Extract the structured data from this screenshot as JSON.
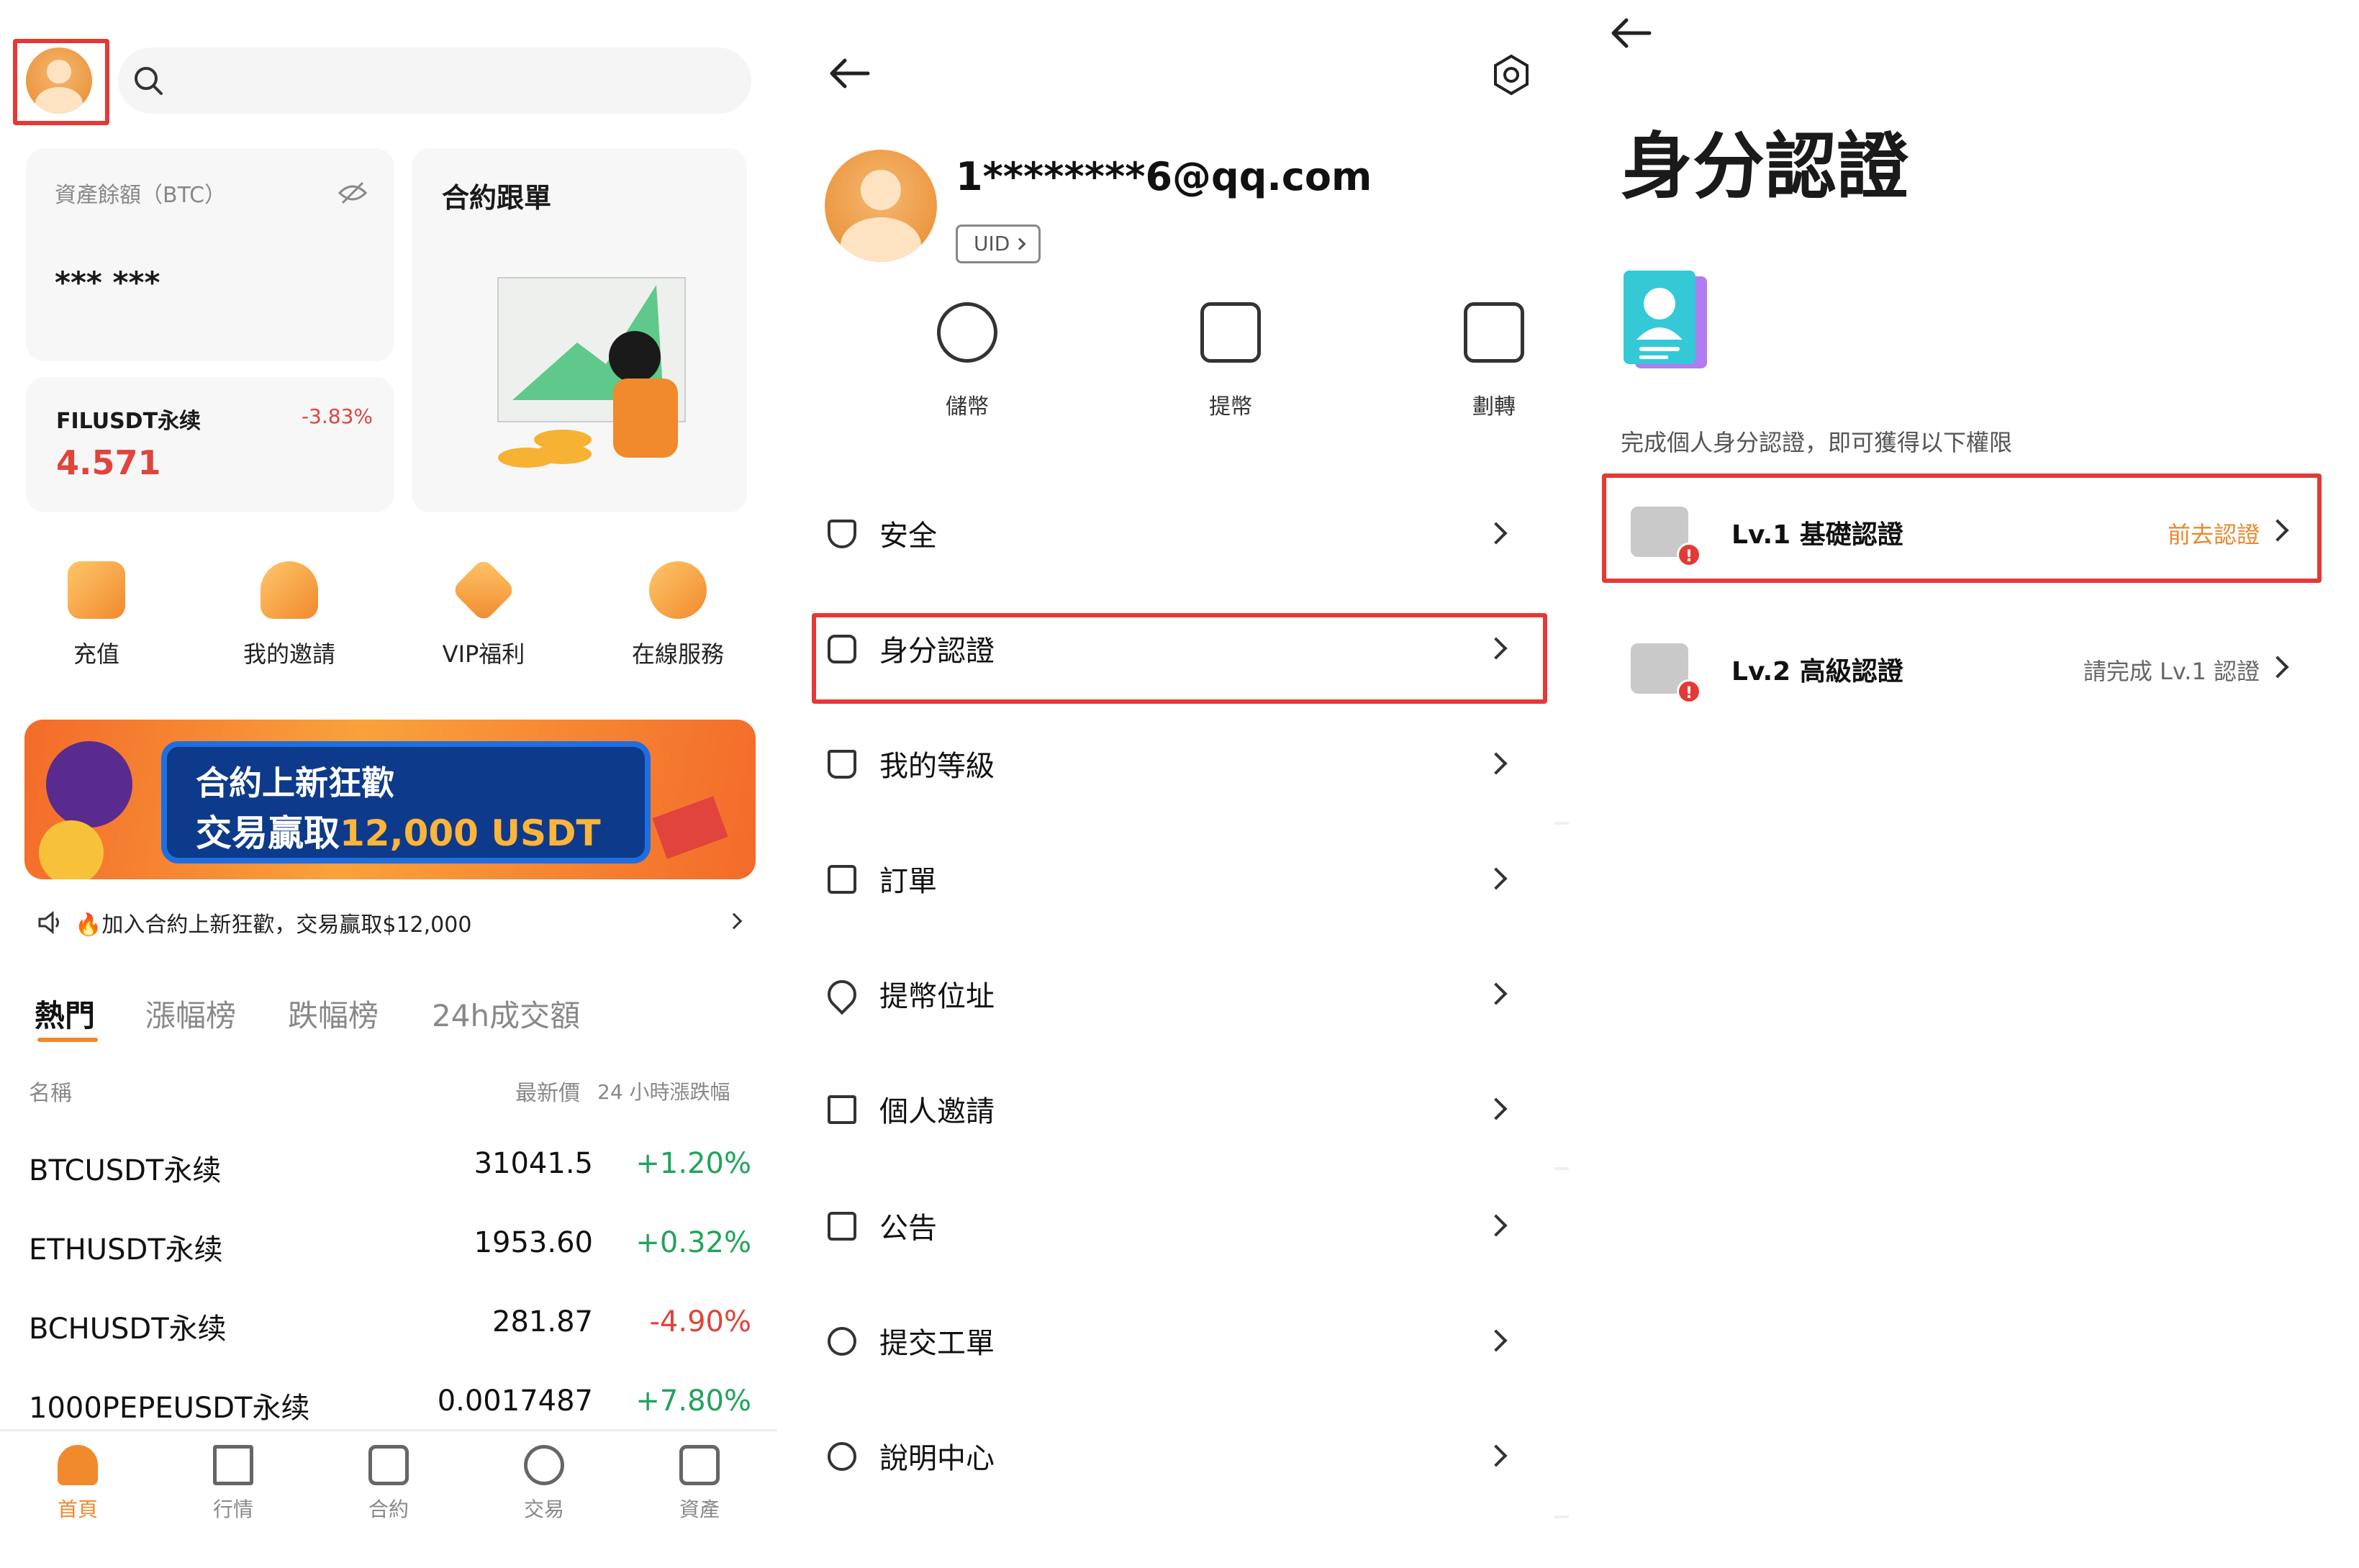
{
  "home": {
    "balance": {
      "label": "資產餘額（BTC）",
      "value": "*** ***"
    },
    "copy_trading": {
      "title": "合約跟單"
    },
    "ticker": {
      "symbol": "FILUSDT永续",
      "change": "-3.83%",
      "price": "4.571"
    },
    "quick_actions": [
      {
        "label": "充值",
        "icon": "deposit-icon"
      },
      {
        "label": "我的邀請",
        "icon": "invite-icon"
      },
      {
        "label": "VIP福利",
        "icon": "vip-icon"
      },
      {
        "label": "在線服務",
        "icon": "support-icon"
      }
    ],
    "banner": {
      "line1": "合約上新狂歡",
      "line2_prefix": "交易贏取",
      "line2_amount": "12,000 USDT"
    },
    "announcement": "🔥加入合約上新狂歡，交易贏取$12,000",
    "market_tabs": [
      "熱門",
      "漲幅榜",
      "跌幅榜",
      "24h成交額"
    ],
    "market_header": {
      "name": "名稱",
      "price": "最新價",
      "change": "24 小時漲跌幅"
    },
    "market_rows": [
      {
        "name": "BTCUSDT永续",
        "price": "31041.5",
        "change": "+1.20%"
      },
      {
        "name": "ETHUSDT永续",
        "price": "1953.60",
        "change": "+0.32%"
      },
      {
        "name": "BCHUSDT永续",
        "price": "281.87",
        "change": "-4.90%"
      },
      {
        "name": "1000PEPEUSDT永续",
        "price": "0.0017487",
        "change": "+7.80%"
      }
    ],
    "bottom_nav": [
      {
        "label": "首頁",
        "icon": "home-icon"
      },
      {
        "label": "行情",
        "icon": "market-icon"
      },
      {
        "label": "合約",
        "icon": "contract-icon"
      },
      {
        "label": "交易",
        "icon": "trade-icon"
      },
      {
        "label": "資產",
        "icon": "wallet-icon"
      }
    ]
  },
  "profile": {
    "email": "1********6@qq.com",
    "uid_label": "UID",
    "actions": [
      {
        "label": "儲幣",
        "icon": "deposit-coin-icon"
      },
      {
        "label": "提幣",
        "icon": "withdraw-icon"
      },
      {
        "label": "劃轉",
        "icon": "transfer-icon"
      }
    ],
    "menu": [
      {
        "label": "安全",
        "icon": "shield-icon"
      },
      {
        "label": "身分認證",
        "icon": "id-card-icon"
      },
      {
        "label": "我的等級",
        "icon": "crown-icon"
      },
      {
        "label": "訂單",
        "icon": "order-icon"
      },
      {
        "label": "提幣位址",
        "icon": "location-icon"
      },
      {
        "label": "個人邀請",
        "icon": "gift-icon"
      },
      {
        "label": "公告",
        "icon": "announcement-icon"
      },
      {
        "label": "提交工單",
        "icon": "ticket-icon"
      },
      {
        "label": "說明中心",
        "icon": "help-icon"
      }
    ]
  },
  "verification": {
    "title": "身分認證",
    "subtitle": "完成個人身分認證，即可獲得以下權限",
    "levels": [
      {
        "title": "Lv.1 基礎認證",
        "status": "前去認證",
        "status_color": "#e8892b",
        "icon": "person-card-icon"
      },
      {
        "title": "Lv.2 高級認證",
        "status": "請完成 Lv.1 認證",
        "status_color": "#666666",
        "icon": "camera-icon"
      }
    ]
  },
  "colors": {
    "accent": "#f08a2d",
    "up": "#21a35b",
    "down": "#e0443c",
    "highlight": "#e53935"
  }
}
